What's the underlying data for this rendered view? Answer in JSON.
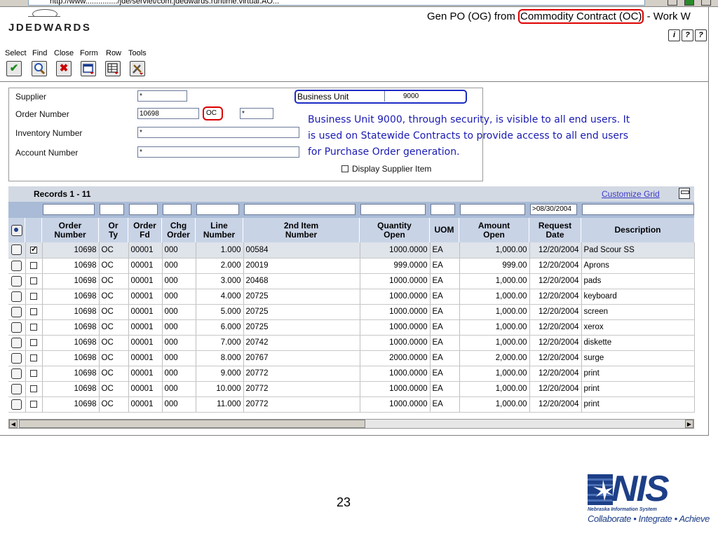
{
  "browser": {
    "url": "http://www.............../jde/servlet/com.jdedwards.runtime.virtual.AO..."
  },
  "header": {
    "logo": "JDEDWARDS",
    "title_prefix": "Gen PO (OG) from ",
    "title_highlight": "Commodity Contract (OC)",
    "title_suffix": " - Work W",
    "help_buttons": [
      "i",
      "?",
      "?"
    ]
  },
  "menu": {
    "items": [
      "Select",
      "Find",
      "Close",
      "Form",
      "Row",
      "Tools"
    ]
  },
  "toolbar": {
    "buttons": [
      "select-icon",
      "find-icon",
      "close-icon",
      "form-icon",
      "row-icon",
      "tools-icon"
    ]
  },
  "criteria": {
    "supplier_label": "Supplier",
    "supplier_value": "*",
    "order_number_label": "Order Number",
    "order_number_value": "10698",
    "order_type_value": "OC",
    "order_company_value": "*",
    "inventory_label": "Inventory Number",
    "inventory_value": "*",
    "account_label": "Account Number",
    "account_value": "*",
    "business_unit_label": "Business Unit",
    "business_unit_value": "9000",
    "display_supplier_item_label": "Display Supplier Item",
    "display_supplier_item_checked": false
  },
  "annotation": {
    "line1": "Business Unit 9000, through security, is visible to all end users.  It",
    "line2": "is used on Statewide Contracts to provide access to all end users",
    "line3": "for Purchase Order generation."
  },
  "grid": {
    "records_label": "Records 1 - 11",
    "customize_label": "Customize Grid",
    "qbe_request_date": ">08/30/2004",
    "columns": [
      "Order Number",
      "Or Ty",
      "Order Fd",
      "Chg Order",
      "Line Number",
      "2nd Item Number",
      "Quantity Open",
      "UOM",
      "Amount Open",
      "Request Date",
      "Description"
    ],
    "rows": [
      {
        "order": "10698",
        "ty": "OC",
        "fd": "00001",
        "chg": "000",
        "line": "1.000",
        "item": "00584",
        "qty": "1000.0000",
        "uom": "EA",
        "amt": "1,000.00",
        "date": "12/20/2004",
        "desc": "Pad Scour SS",
        "checked": true
      },
      {
        "order": "10698",
        "ty": "OC",
        "fd": "00001",
        "chg": "000",
        "line": "2.000",
        "item": "20019",
        "qty": "999.0000",
        "uom": "EA",
        "amt": "999.00",
        "date": "12/20/2004",
        "desc": "Aprons",
        "checked": false
      },
      {
        "order": "10698",
        "ty": "OC",
        "fd": "00001",
        "chg": "000",
        "line": "3.000",
        "item": "20468",
        "qty": "1000.0000",
        "uom": "EA",
        "amt": "1,000.00",
        "date": "12/20/2004",
        "desc": "pads",
        "checked": false
      },
      {
        "order": "10698",
        "ty": "OC",
        "fd": "00001",
        "chg": "000",
        "line": "4.000",
        "item": "20725",
        "qty": "1000.0000",
        "uom": "EA",
        "amt": "1,000.00",
        "date": "12/20/2004",
        "desc": "keyboard",
        "checked": false
      },
      {
        "order": "10698",
        "ty": "OC",
        "fd": "00001",
        "chg": "000",
        "line": "5.000",
        "item": "20725",
        "qty": "1000.0000",
        "uom": "EA",
        "amt": "1,000.00",
        "date": "12/20/2004",
        "desc": "screen",
        "checked": false
      },
      {
        "order": "10698",
        "ty": "OC",
        "fd": "00001",
        "chg": "000",
        "line": "6.000",
        "item": "20725",
        "qty": "1000.0000",
        "uom": "EA",
        "amt": "1,000.00",
        "date": "12/20/2004",
        "desc": "xerox",
        "checked": false
      },
      {
        "order": "10698",
        "ty": "OC",
        "fd": "00001",
        "chg": "000",
        "line": "7.000",
        "item": "20742",
        "qty": "1000.0000",
        "uom": "EA",
        "amt": "1,000.00",
        "date": "12/20/2004",
        "desc": "diskette",
        "checked": false
      },
      {
        "order": "10698",
        "ty": "OC",
        "fd": "00001",
        "chg": "000",
        "line": "8.000",
        "item": "20767",
        "qty": "2000.0000",
        "uom": "EA",
        "amt": "2,000.00",
        "date": "12/20/2004",
        "desc": "surge",
        "checked": false
      },
      {
        "order": "10698",
        "ty": "OC",
        "fd": "00001",
        "chg": "000",
        "line": "9.000",
        "item": "20772",
        "qty": "1000.0000",
        "uom": "EA",
        "amt": "1,000.00",
        "date": "12/20/2004",
        "desc": "print",
        "checked": false
      },
      {
        "order": "10698",
        "ty": "OC",
        "fd": "00001",
        "chg": "000",
        "line": "10.000",
        "item": "20772",
        "qty": "1000.0000",
        "uom": "EA",
        "amt": "1,000.00",
        "date": "12/20/2004",
        "desc": "print",
        "checked": false
      },
      {
        "order": "10698",
        "ty": "OC",
        "fd": "00001",
        "chg": "000",
        "line": "11.000",
        "item": "20772",
        "qty": "1000.0000",
        "uom": "EA",
        "amt": "1,000.00",
        "date": "12/20/2004",
        "desc": "print",
        "checked": false
      }
    ]
  },
  "footer": {
    "page_number": "23",
    "logo_text": "NIS",
    "logo_sub": "Nebraska Information System",
    "logo_tagline": "Collaborate • Integrate • Achieve"
  },
  "colors": {
    "highlight_red": "#dd0000",
    "highlight_blue": "#1d2bc4",
    "annotation_text": "#1a1ab4",
    "grid_header": "#c8d3e6",
    "nis_blue": "#1d3f87"
  }
}
